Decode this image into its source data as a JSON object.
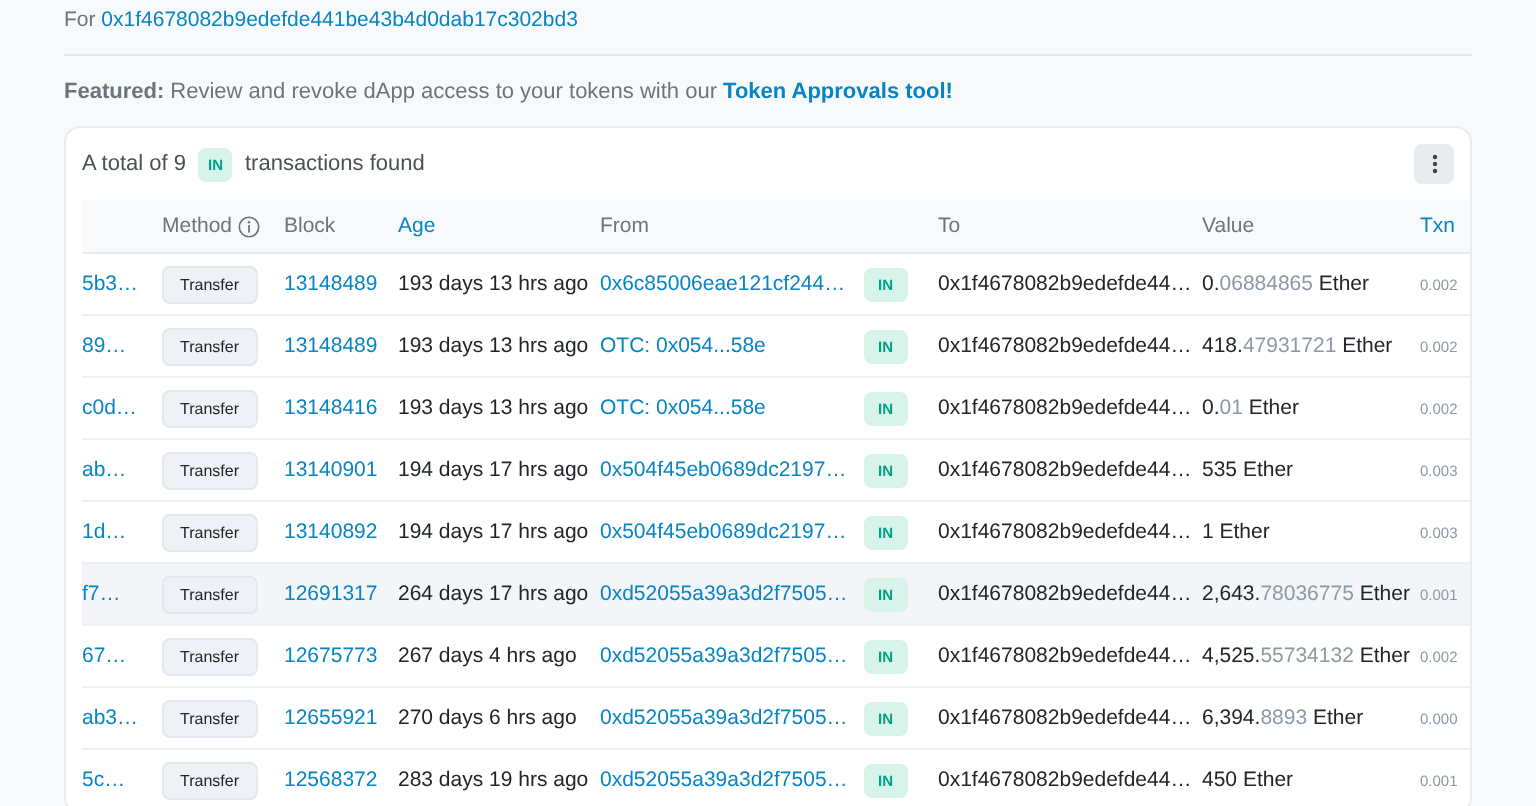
{
  "address_line": {
    "label": "For",
    "address": "0x1f4678082b9edefde441be43b4d0dab17c302bd3"
  },
  "featured": {
    "label": "Featured:",
    "text": "Review and revoke dApp access to your tokens with our",
    "link": "Token Approvals tool!"
  },
  "card": {
    "summary_before": "A total of 9",
    "badge": "IN",
    "summary_after": "transactions found"
  },
  "table": {
    "columns": [
      {
        "label": "Method",
        "kind": "info"
      },
      {
        "label": "Block",
        "kind": "plain"
      },
      {
        "label": "Age",
        "kind": "link"
      },
      {
        "label": "From",
        "kind": "plain"
      },
      {
        "label": "To",
        "kind": "plain"
      },
      {
        "label": "Value",
        "kind": "plain"
      },
      {
        "label": "Txn",
        "kind": "link"
      }
    ],
    "rows": [
      {
        "hash": "5b3…",
        "method": "Transfer",
        "block": "13148489",
        "age": "193 days 13 hrs ago",
        "from": "0x6c85006eae121cf244…",
        "direction": "IN",
        "to": "0x1f4678082b9edefde44…",
        "value_whole": "0.",
        "value_fraction": "06884865",
        "unit": "Ether",
        "fee": "0.002",
        "hovered": false
      },
      {
        "hash": "89…",
        "method": "Transfer",
        "block": "13148489",
        "age": "193 days 13 hrs ago",
        "from": "OTC: 0x054...58e",
        "direction": "IN",
        "to": "0x1f4678082b9edefde44…",
        "value_whole": "418.",
        "value_fraction": "47931721",
        "unit": "Ether",
        "fee": "0.002",
        "hovered": false
      },
      {
        "hash": "c0d…",
        "method": "Transfer",
        "block": "13148416",
        "age": "193 days 13 hrs ago",
        "from": "OTC: 0x054...58e",
        "direction": "IN",
        "to": "0x1f4678082b9edefde44…",
        "value_whole": "0.",
        "value_fraction": "01",
        "unit": "Ether",
        "fee": "0.002",
        "hovered": false
      },
      {
        "hash": "ab…",
        "method": "Transfer",
        "block": "13140901",
        "age": "194 days 17 hrs ago",
        "from": "0x504f45eb0689dc2197…",
        "direction": "IN",
        "to": "0x1f4678082b9edefde44…",
        "value_whole": "535",
        "value_fraction": "",
        "unit": "Ether",
        "fee": "0.003",
        "hovered": false
      },
      {
        "hash": "1d…",
        "method": "Transfer",
        "block": "13140892",
        "age": "194 days 17 hrs ago",
        "from": "0x504f45eb0689dc2197…",
        "direction": "IN",
        "to": "0x1f4678082b9edefde44…",
        "value_whole": "1",
        "value_fraction": "",
        "unit": "Ether",
        "fee": "0.003",
        "hovered": false
      },
      {
        "hash": "f7…",
        "method": "Transfer",
        "block": "12691317",
        "age": "264 days 17 hrs ago",
        "from": "0xd52055a39a3d2f7505…",
        "direction": "IN",
        "to": "0x1f4678082b9edefde44…",
        "value_whole": "2,643.",
        "value_fraction": "78036775",
        "unit": "Ether",
        "fee": "0.001",
        "hovered": true
      },
      {
        "hash": "67…",
        "method": "Transfer",
        "block": "12675773",
        "age": "267 days 4 hrs ago",
        "from": "0xd52055a39a3d2f7505…",
        "direction": "IN",
        "to": "0x1f4678082b9edefde44…",
        "value_whole": "4,525.",
        "value_fraction": "55734132",
        "unit": "Ether",
        "fee": "0.002",
        "hovered": false
      },
      {
        "hash": "ab3…",
        "method": "Transfer",
        "block": "12655921",
        "age": "270 days 6 hrs ago",
        "from": "0xd52055a39a3d2f7505…",
        "direction": "IN",
        "to": "0x1f4678082b9edefde44…",
        "value_whole": "6,394.",
        "value_fraction": "8893",
        "unit": "Ether",
        "fee": "0.000",
        "hovered": false
      },
      {
        "hash": "5c…",
        "method": "Transfer",
        "block": "12568372",
        "age": "283 days 19 hrs ago",
        "from": "0xd52055a39a3d2f7505…",
        "direction": "IN",
        "to": "0x1f4678082b9edefde44…",
        "value_whole": "450",
        "value_fraction": "",
        "unit": "Ether",
        "fee": "0.001",
        "hovered": false
      }
    ]
  }
}
